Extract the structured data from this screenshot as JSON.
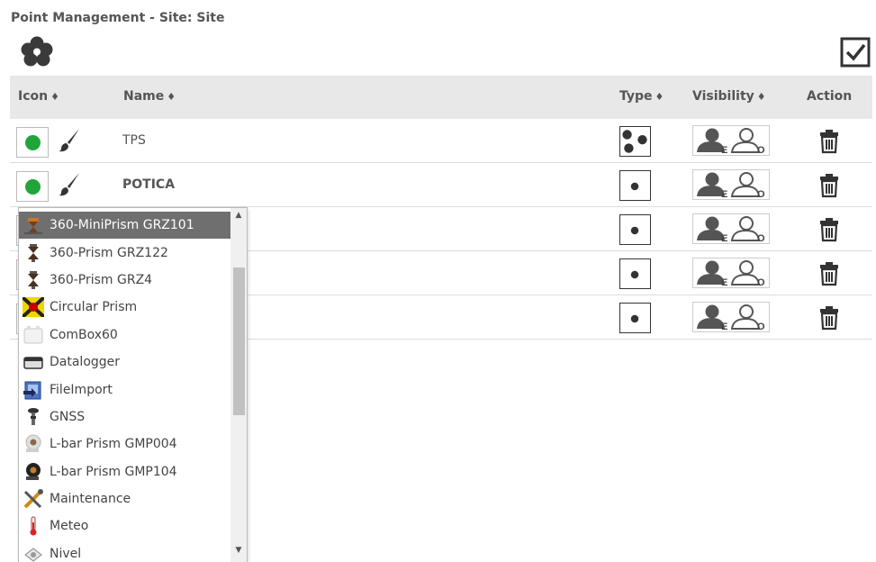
{
  "page": {
    "title": "Point Management - Site: Site"
  },
  "table": {
    "headers": {
      "icon": "Icon",
      "name": "Name",
      "type": "Type",
      "visibility": "Visibility",
      "action": "Action",
      "sort_glyph": "♦"
    },
    "rows": [
      {
        "name": "TPS",
        "bold": false,
        "type_icon": "multi-dot-icon"
      },
      {
        "name": "POTICA",
        "bold": true,
        "type_icon": "single-dot-icon"
      },
      {
        "name": "",
        "bold": false,
        "type_icon": "single-dot-icon"
      },
      {
        "name": "",
        "bold": false,
        "type_icon": "single-dot-icon"
      },
      {
        "name": "",
        "bold": false,
        "type_icon": "single-dot-icon"
      }
    ],
    "visibility_letters": {
      "first": "E",
      "second": "O"
    }
  },
  "icon_dropdown": {
    "selected": "360-MiniPrism GRZ101",
    "items": [
      {
        "label": "360-MiniPrism GRZ101",
        "icon": "mini-prism-icon"
      },
      {
        "label": "360-Prism GRZ122",
        "icon": "prism-icon"
      },
      {
        "label": "360-Prism GRZ4",
        "icon": "prism-icon"
      },
      {
        "label": "Circular Prism",
        "icon": "circular-prism-icon"
      },
      {
        "label": "ComBox60",
        "icon": "combox-icon"
      },
      {
        "label": "Datalogger",
        "icon": "datalogger-icon"
      },
      {
        "label": "FileImport",
        "icon": "file-import-icon"
      },
      {
        "label": "GNSS",
        "icon": "gnss-icon"
      },
      {
        "label": "L-bar Prism GMP004",
        "icon": "l-bar-prism-icon"
      },
      {
        "label": "L-bar Prism GMP104",
        "icon": "l-bar-prism-dark-icon"
      },
      {
        "label": "Maintenance",
        "icon": "maintenance-icon"
      },
      {
        "label": "Meteo",
        "icon": "thermometer-icon"
      },
      {
        "label": "Nivel",
        "icon": "nivel-icon"
      }
    ]
  },
  "colors": {
    "status_green": "#21a53b",
    "header_bg": "#e8e8e8",
    "selected_item_bg": "#6f6f6f"
  }
}
